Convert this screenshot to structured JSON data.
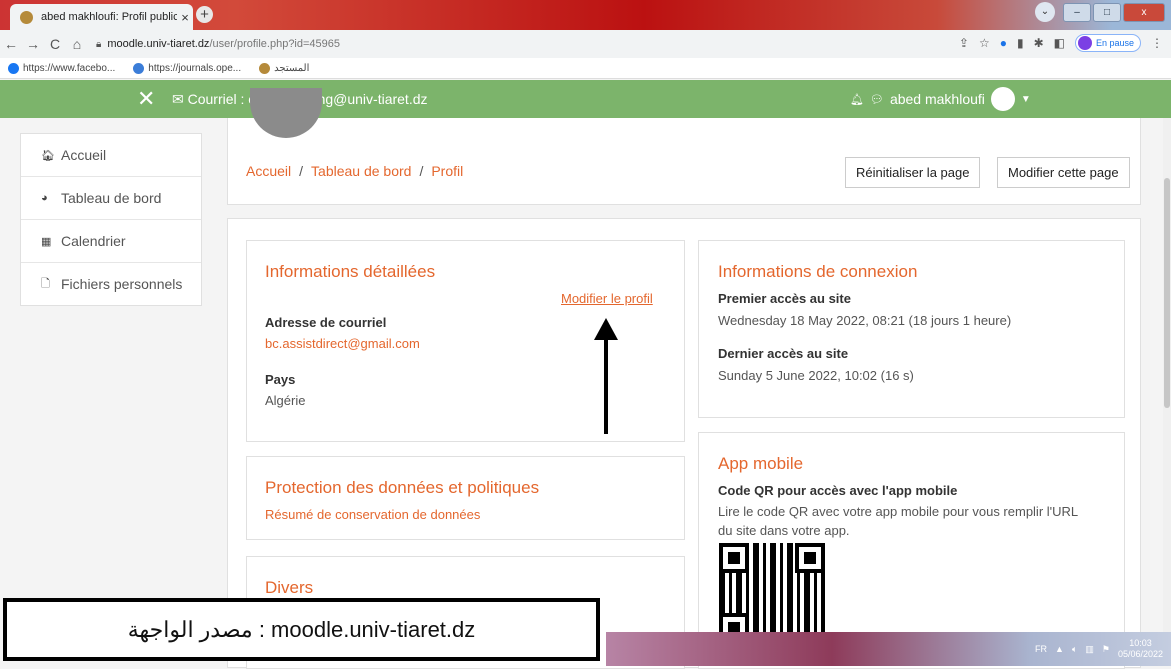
{
  "browser": {
    "tab_title": "abed makhloufi: Profil public",
    "tab_close": "×",
    "new_tab": "+",
    "url_host": "moodle.univ-tiaret.dz",
    "url_path": "/user/profile.php?id=45965",
    "profile_status": "En pause",
    "bookmarks": [
      "https://www.facebo...",
      "https://journals.ope...",
      "المستجد"
    ]
  },
  "navbar": {
    "mail_label": "Courriel : ens-elearning@univ-tiaret.dz",
    "user_name": "abed makhloufi"
  },
  "sidebar": {
    "items": [
      {
        "label": "Accueil",
        "icon": "home-icon"
      },
      {
        "label": "Tableau de bord",
        "icon": "dashboard-icon"
      },
      {
        "label": "Calendrier",
        "icon": "calendar-icon"
      },
      {
        "label": "Fichiers personnels",
        "icon": "file-icon"
      }
    ]
  },
  "header": {
    "breadcrumb": [
      "Accueil",
      "Tableau de bord",
      "Profil"
    ],
    "breadcrumb_sep": "/",
    "reset_button": "Réinitialiser la page",
    "edit_page_button": "Modifier cette page"
  },
  "details": {
    "title": "Informations détaillées",
    "edit_profile": "Modifier le profil",
    "email_label": "Adresse de courriel",
    "email_value": "bc.assistdirect@gmail.com",
    "country_label": "Pays",
    "country_value": "Algérie"
  },
  "login": {
    "title": "Informations de connexion",
    "first_label": "Premier accès au site",
    "first_value": "Wednesday 18 May 2022, 08:21  (18 jours 1 heure)",
    "last_label": "Dernier accès au site",
    "last_value": "Sunday 5 June 2022, 10:02  (16 s)"
  },
  "privacy": {
    "title": "Protection des données et politiques",
    "link": "Résumé de conservation de données"
  },
  "misc": {
    "title": "Divers"
  },
  "mobile": {
    "title": "App mobile",
    "qr_label": "Code QR pour accès avec l'app mobile",
    "qr_text": "Lire le code QR avec votre app mobile pour vous remplir l'URL du site dans votre app."
  },
  "source_caption": "مصدر الواجهة : moodle.univ-tiaret.dz",
  "taskbar": {
    "lang": "FR",
    "time": "10:03",
    "date": "05/06/2022"
  },
  "colors": {
    "accent": "#e4672e",
    "navbar": "#7cb46b"
  }
}
